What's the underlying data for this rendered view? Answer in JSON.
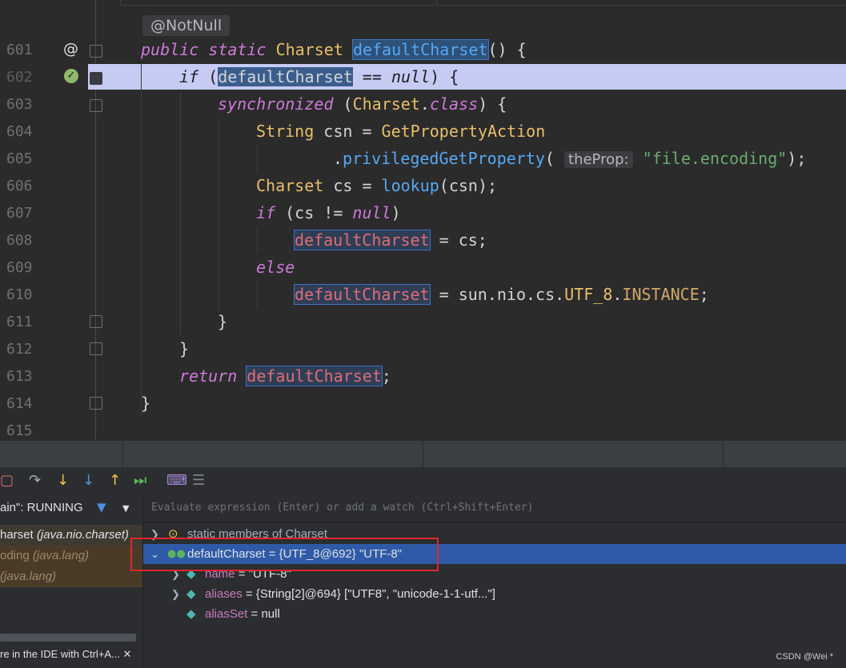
{
  "editor": {
    "annotation": "@NotNull",
    "param_hint": "theProp:",
    "lines": [
      {
        "num": "601"
      },
      {
        "num": "602"
      },
      {
        "num": "603"
      },
      {
        "num": "604"
      },
      {
        "num": "605"
      },
      {
        "num": "606"
      },
      {
        "num": "607"
      },
      {
        "num": "608"
      },
      {
        "num": "609"
      },
      {
        "num": "610"
      },
      {
        "num": "611"
      },
      {
        "num": "612"
      },
      {
        "num": "613"
      },
      {
        "num": "614"
      },
      {
        "num": "615"
      }
    ],
    "tokens": {
      "public": "public",
      "static": "static",
      "charset_type": "Charset",
      "method_name": "defaultCharset",
      "sig_rest": "() {",
      "if": "if",
      "paren_open": "(",
      "cond_var": "defaultCharset",
      "eq_null": " == ",
      "null": "null",
      "cond_close": ") {",
      "synchronized": "synchronized",
      "sync_open": " (",
      "sync_class_type": "Charset",
      "dot": ".",
      "class_kw": "class",
      "sync_close": ") {",
      "string_type": "String",
      "csn_decl": " csn = ",
      "gpa": "GetPropertyAction",
      "dot2": ".",
      "pgp": "privilegedGetProperty",
      "pgp_open": "(",
      "file_encoding": "\"file.encoding\"",
      "pgp_close": ");",
      "charset_type2": "Charset",
      "cs_decl": " cs = ",
      "lookup": "lookup",
      "lookup_args": "(csn);",
      "if2": "if",
      "cs_cond_a": " (cs != ",
      "null2": "null",
      "cs_cond_b": ")",
      "assign_var1": "defaultCharset",
      "assign_cs": " = cs;",
      "else": "else",
      "assign_var2": "defaultCharset",
      "assign_eq": " = sun.nio.cs.",
      "utf8": "UTF_8",
      "dot3": ".",
      "instance": "INSTANCE",
      "semi": ";",
      "brace1": "}",
      "brace2": "}",
      "return": "return",
      "ret_var": "defaultCharset",
      "ret_semi": ";",
      "brace3": "}"
    }
  },
  "debugger": {
    "thread_label": "ain\": RUNNING",
    "frames": [
      {
        "label": "harset",
        "detail": "(java.nio.charset)"
      },
      {
        "label": "oding",
        "detail": "(java.lang)"
      },
      {
        "label": "",
        "detail": "(java.lang)"
      }
    ],
    "frames_footer": "re in the IDE with Ctrl+A...",
    "close_glyph": "✕",
    "eval_placeholder": "Evaluate expression (Enter) or add a watch (Ctrl+Shift+Enter)",
    "variables": [
      {
        "name": "static members of Charset",
        "value": "",
        "kind": "static"
      },
      {
        "name": "defaultCharset",
        "value": " = {UTF_8@692} \"UTF-8\"",
        "kind": "selected"
      },
      {
        "name": "name",
        "value": " = \"UTF-8\"",
        "kind": "field"
      },
      {
        "name": "aliases",
        "value": " = {String[2]@694} [\"UTF8\", \"unicode-1-1-utf...\"]",
        "kind": "field"
      },
      {
        "name": "aliasSet",
        "value": " = null",
        "kind": "field"
      }
    ]
  },
  "watermark": "CSDN @Wei *",
  "colors": {
    "highlight_row": "#c6cbf4",
    "selection": "#2e5aa8",
    "red_box": "#e0262b"
  }
}
